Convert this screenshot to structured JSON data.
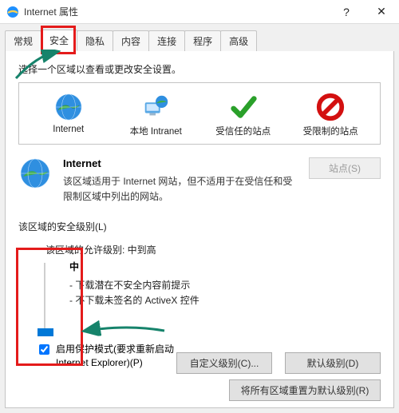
{
  "titlebar": {
    "title": "Internet 属性",
    "help_label": "?",
    "close_label": "✕"
  },
  "tabs": [
    {
      "id": "general",
      "label": "常规"
    },
    {
      "id": "security",
      "label": "安全"
    },
    {
      "id": "privacy",
      "label": "隐私"
    },
    {
      "id": "content",
      "label": "内容"
    },
    {
      "id": "conn",
      "label": "连接"
    },
    {
      "id": "programs",
      "label": "程序"
    },
    {
      "id": "advanced",
      "label": "高级"
    }
  ],
  "active_tab": "security",
  "security": {
    "select_zone_text": "选择一个区域以查看或更改安全设置。",
    "zones": [
      {
        "id": "internet",
        "label": "Internet",
        "icon": "globe"
      },
      {
        "id": "intranet",
        "label": "本地 Intranet",
        "icon": "computer-globe"
      },
      {
        "id": "trusted",
        "label": "受信任的站点",
        "icon": "check"
      },
      {
        "id": "restricted",
        "label": "受限制的站点",
        "icon": "forbid"
      }
    ],
    "selected_zone": "internet",
    "zone_detail": {
      "title": "Internet",
      "desc": "该区域适用于 Internet 网站，但不适用于在受信任和受限制区域中列出的网站。",
      "sites_button": "站点(S)"
    },
    "level": {
      "group_label": "该区域的安全级别(L)",
      "allowed_label": "该区域的允许级别: 中到高",
      "current_name": "中",
      "bullets": [
        "下载潜在不安全内容前提示",
        "不下载未签名的 ActiveX 控件"
      ]
    },
    "protect_mode": {
      "checked": true,
      "label": "启用保护模式(要求重新启动 Internet Explorer)(P)"
    },
    "buttons": {
      "custom": "自定义级别(C)...",
      "default": "默认级别(D)",
      "reset_all": "将所有区域重置为默认级别(R)"
    }
  }
}
